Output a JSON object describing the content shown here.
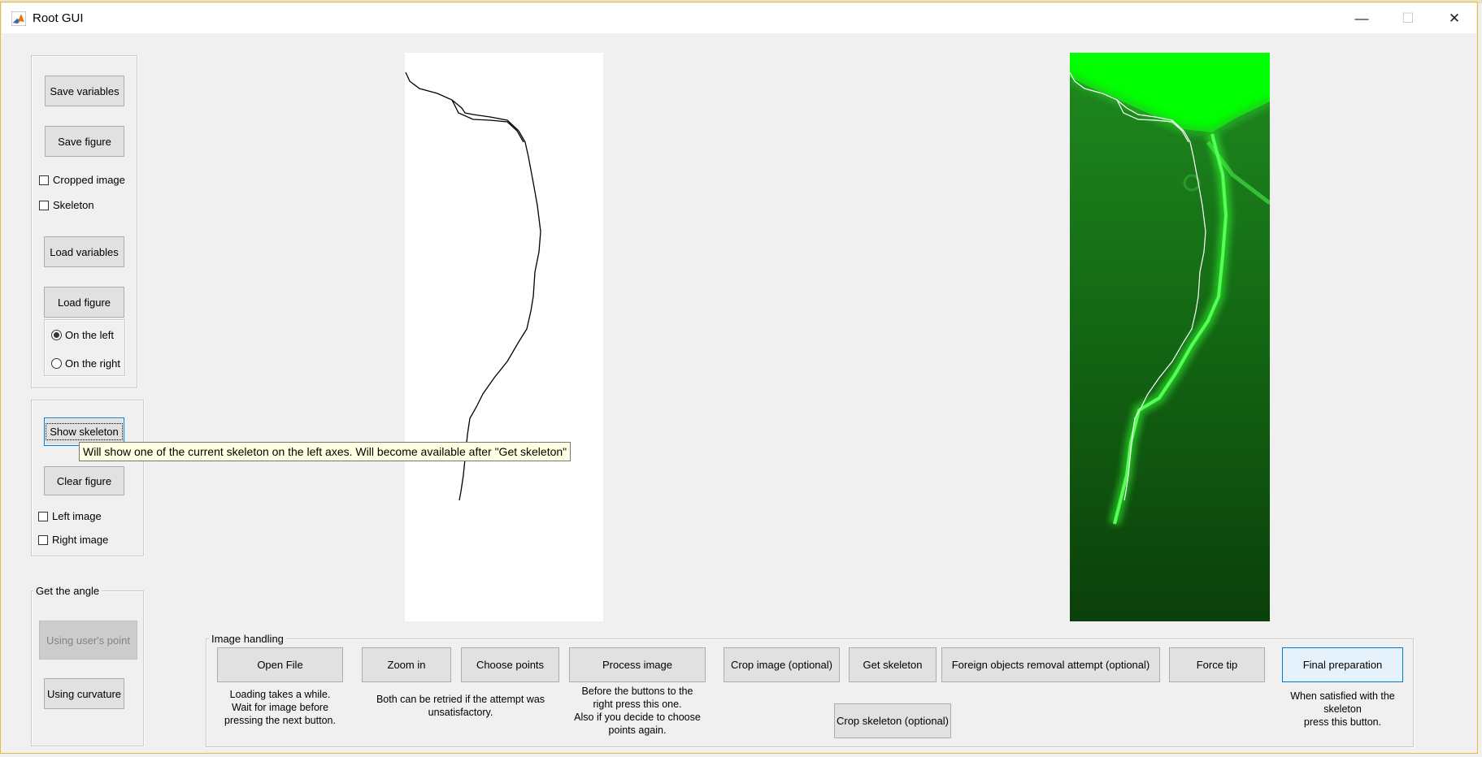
{
  "window": {
    "title": "Root GUI",
    "controls": {
      "minimize": "—",
      "maximize": "☐",
      "close": "✕"
    }
  },
  "left_panel": {
    "save_variables": "Save variables",
    "save_figure": "Save figure",
    "cropped_image": "Cropped image",
    "skeleton": "Skeleton",
    "load_variables": "Load variables",
    "load_figure": "Load figure",
    "radio_on_left": "On the left",
    "radio_on_right": "On the right",
    "selected_radio": "On the left"
  },
  "show_panel": {
    "show_skeleton": "Show skeleton",
    "clear_figure": "Clear figure",
    "left_image": "Left image",
    "right_image": "Right image"
  },
  "tooltip": {
    "text": "Will show one of the current skeleton on the left axes. Will become available after  \"Get skeleton\""
  },
  "angle_panel": {
    "title": "Get the angle",
    "using_users_point": "Using user's point",
    "using_curvature": "Using curvature"
  },
  "image_handling": {
    "title": "Image handling",
    "open_file": "Open File",
    "zoom_in": "Zoom in",
    "choose_points": "Choose points",
    "process_image": "Process image",
    "crop_image": "Crop image (optional)",
    "get_skeleton": "Get skeleton",
    "foreign_objects": "Foreign objects removal attempt (optional)",
    "force_tip": "Force tip",
    "final_preparation": "Final preparation",
    "crop_skeleton": "Crop skeleton (optional)",
    "note_open_file": [
      "Loading takes a while.",
      "Wait for  image before",
      "pressing the next button."
    ],
    "note_zoom_choose": [
      "Both can be retried if the attempt was",
      "unsatisfactory."
    ],
    "note_process": [
      "Before the buttons to the",
      "right press this one.",
      "Also if you decide to choose",
      "points again."
    ],
    "note_final": [
      "When satisfied with the",
      "skeleton",
      "press this button."
    ]
  },
  "colors": {
    "accent": "#0078d7",
    "tooltip_bg": "#ffffe1",
    "image_green": "#00ff00"
  }
}
